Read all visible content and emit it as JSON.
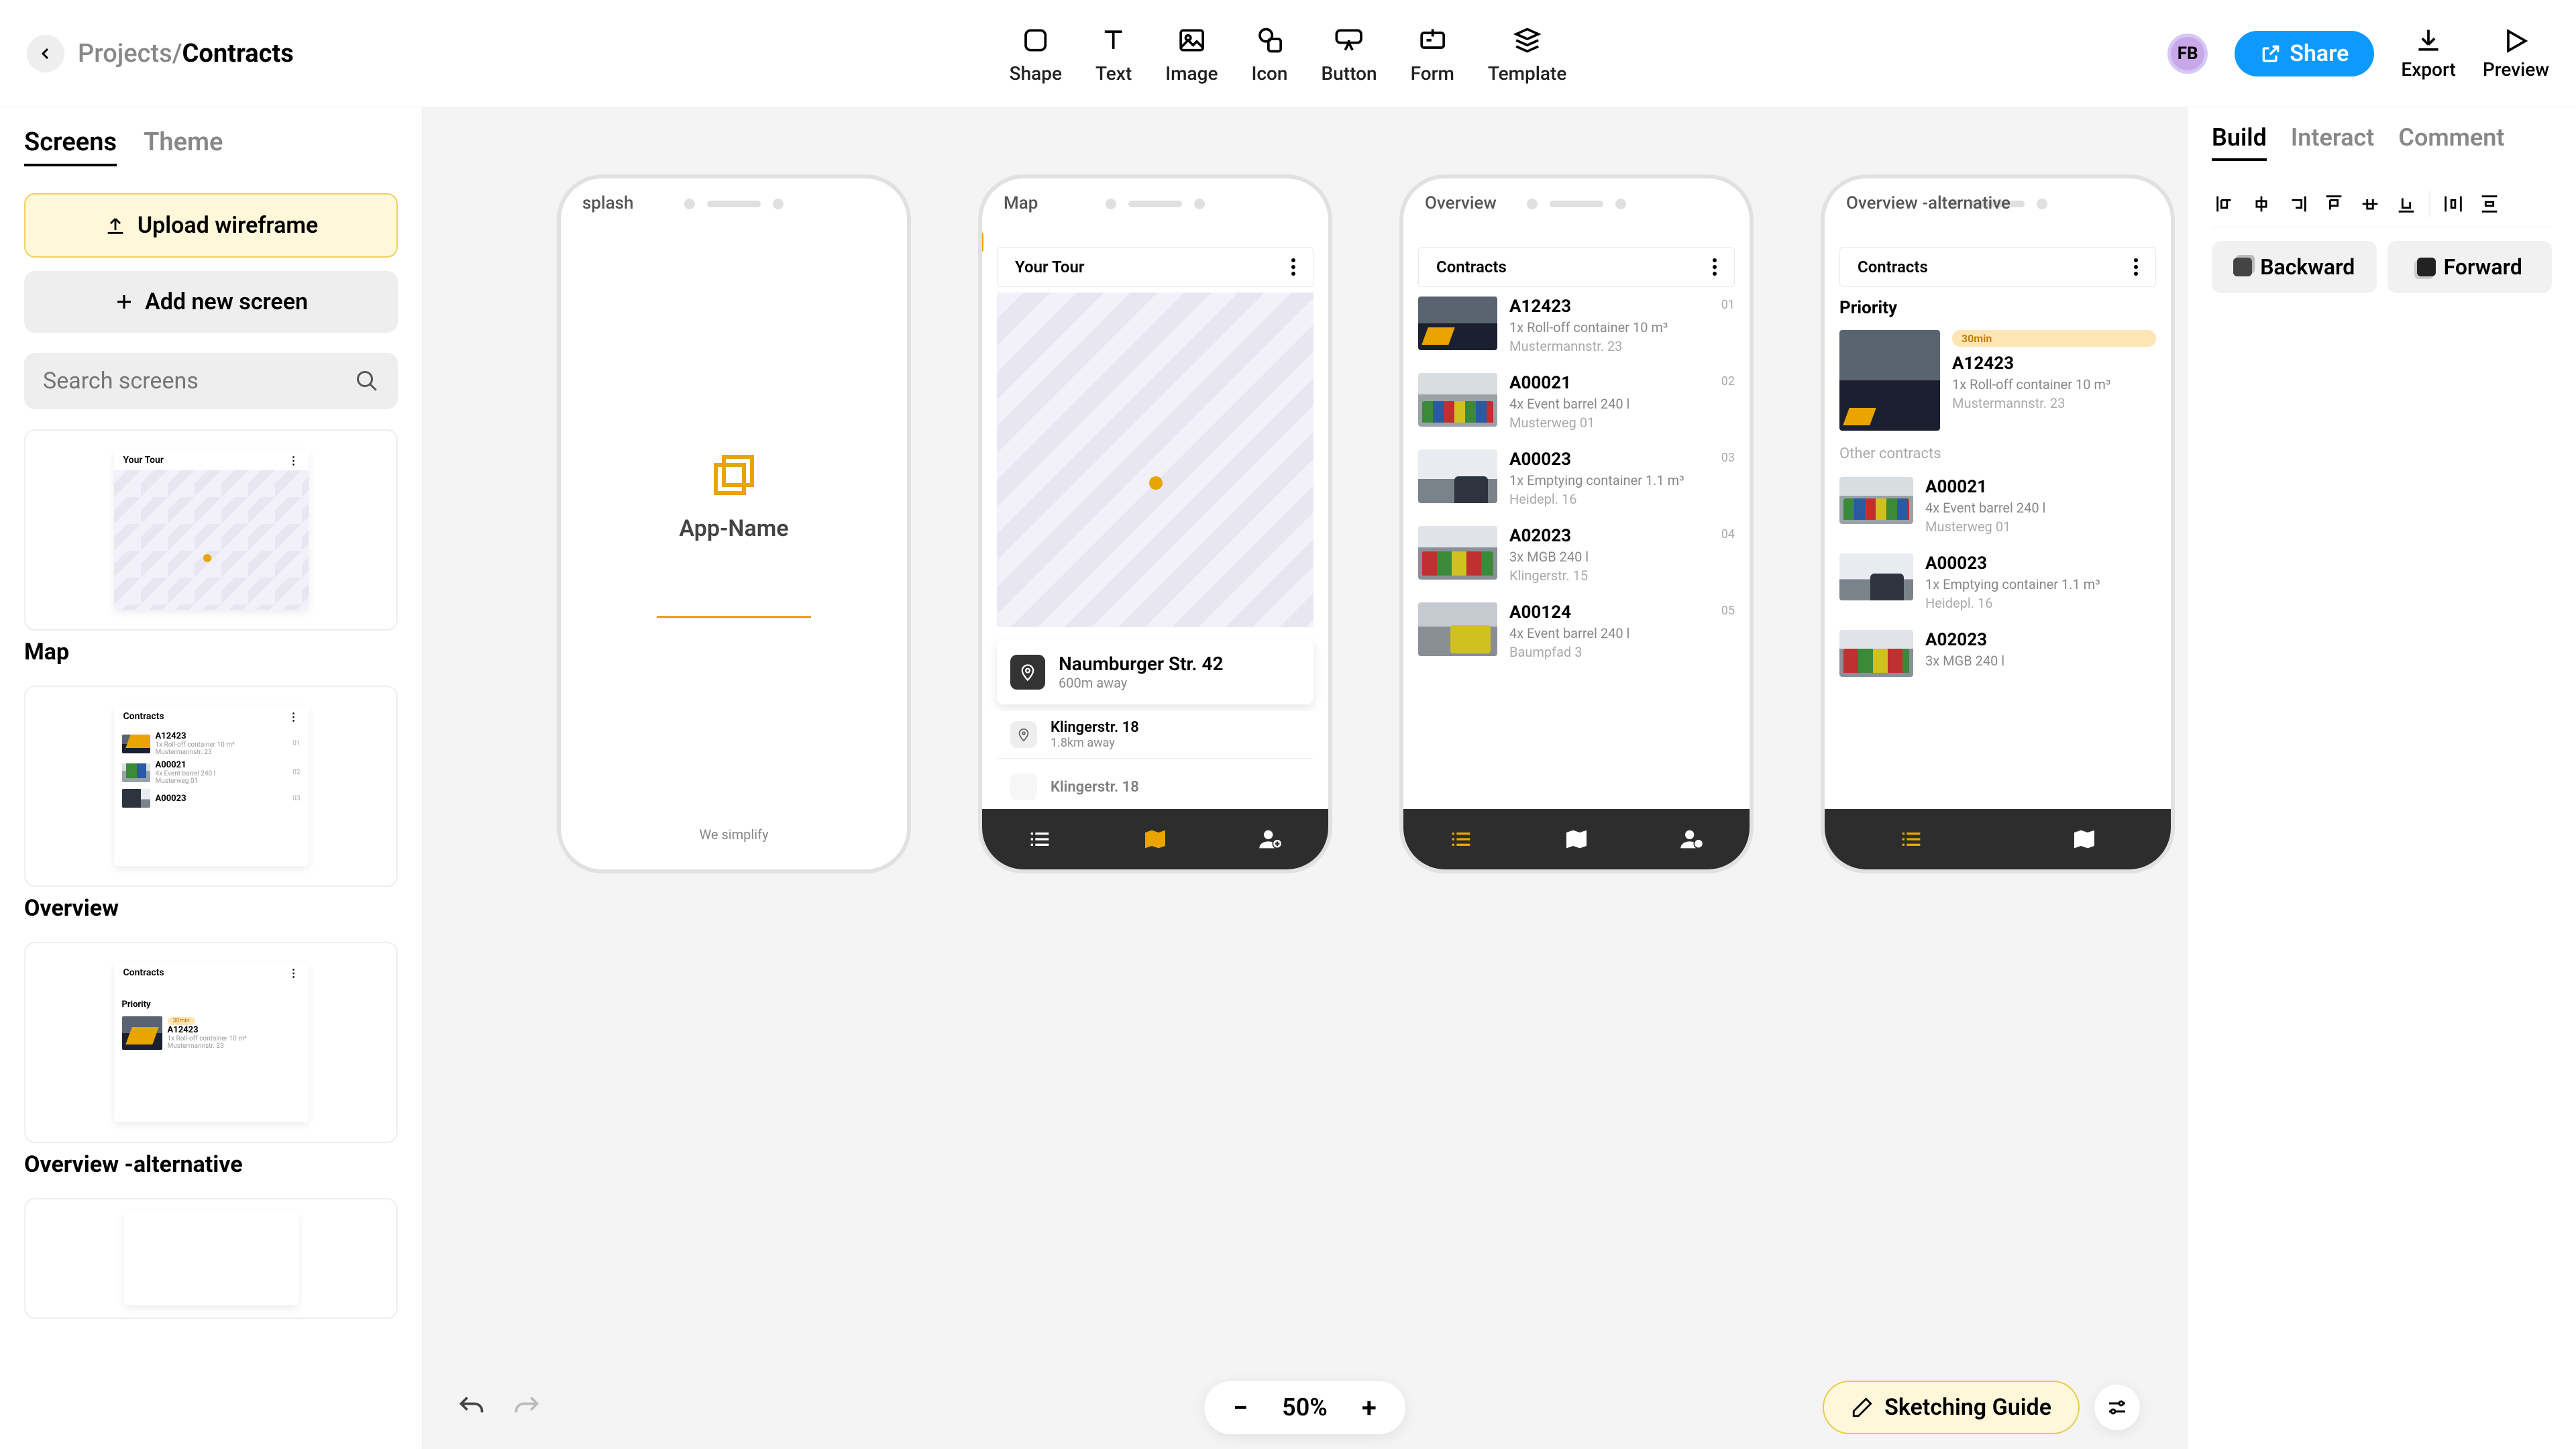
{
  "breadcrumb": {
    "projects": "Projects",
    "sep": "/",
    "current": "Contracts"
  },
  "toolbar": {
    "shape": "Shape",
    "text": "Text",
    "image": "Image",
    "icon": "Icon",
    "button": "Button",
    "form": "Form",
    "template": "Template"
  },
  "header": {
    "avatar": "FB",
    "share": "Share",
    "export": "Export",
    "preview": "Preview"
  },
  "leftPanel": {
    "tabs": {
      "screens": "Screens",
      "theme": "Theme"
    },
    "upload": "Upload wireframe",
    "add": "Add new screen",
    "searchPlaceholder": "Search screens",
    "screens": [
      {
        "title": "Map"
      },
      {
        "title": "Overview"
      },
      {
        "title": "Overview -alternative"
      }
    ]
  },
  "canvas": {
    "zoom": "50%",
    "sketchGuide": "Sketching Guide",
    "frames": {
      "splash": {
        "label": "splash",
        "appName": "App-Name",
        "footer": "We simplify"
      },
      "map": {
        "label": "Map",
        "barTitle": "Your Tour",
        "primary": {
          "title": "Naumburger Str. 42",
          "sub": "600m away"
        },
        "items": [
          {
            "title": "Klingerstr. 18",
            "sub": "1.8km away"
          },
          {
            "title": "Klingerstr. 18",
            "sub": ""
          }
        ]
      },
      "overview": {
        "label": "Overview",
        "barTitle": "Contracts",
        "items": [
          {
            "id": "A12423",
            "desc": "1x Roll-off container 10 m³",
            "addr": "Mustermannstr. 23",
            "num": "01",
            "t": "t1"
          },
          {
            "id": "A00021",
            "desc": "4x Event barrel 240 l",
            "addr": "Musterweg 01",
            "num": "02",
            "t": "t2"
          },
          {
            "id": "A00023",
            "desc": "1x Emptying container 1.1 m³",
            "addr": "Heidepl. 16",
            "num": "03",
            "t": "t3"
          },
          {
            "id": "A02023",
            "desc": "3x MGB 240 l",
            "addr": "Klingerstr. 15",
            "num": "04",
            "t": "t4"
          },
          {
            "id": "A00124",
            "desc": "4x Event barrel 240 l",
            "addr": "Baumpfad 3",
            "num": "05",
            "t": "t5"
          }
        ]
      },
      "overviewAlt": {
        "label": "Overview -alternative",
        "barTitle": "Contracts",
        "prioLabel": "Priority",
        "badge": "30min",
        "prio": {
          "id": "A12423",
          "desc": "1x Roll-off container 10 m³",
          "addr": "Mustermannstr. 23"
        },
        "otherLabel": "Other contracts",
        "items": [
          {
            "id": "A00021",
            "desc": "4x Event barrel 240 l",
            "addr": "Musterweg 01",
            "t": "t2"
          },
          {
            "id": "A00023",
            "desc": "1x Emptying container 1.1 m³",
            "addr": "Heidepl. 16",
            "t": "t3"
          },
          {
            "id": "A02023",
            "desc": "3x MGB 240 l",
            "addr": "",
            "t": "t4"
          }
        ]
      }
    }
  },
  "rightPanel": {
    "tabs": {
      "build": "Build",
      "interact": "Interact",
      "comment": "Comment"
    },
    "backward": "Backward",
    "forward": "Forward"
  },
  "thumbs": {
    "map": {
      "bar": "Your Tour"
    },
    "overview": {
      "bar": "Contracts",
      "rows": [
        {
          "id": "A12423",
          "desc": "1x Roll-off container 10 m³",
          "addr": "Mustermannstr. 23",
          "num": "01"
        },
        {
          "id": "A00021",
          "desc": "4x Event barrel 240 l",
          "addr": "Musterweg 01",
          "num": "02"
        },
        {
          "id": "A00023",
          "desc": "",
          "addr": "",
          "num": "03"
        }
      ]
    },
    "overviewAlt": {
      "bar": "Contracts",
      "prio": "Priority",
      "badge": "30min",
      "id": "A12423",
      "desc": "1x Roll-off container 10 m³",
      "addr": "Mustermannstr. 23"
    }
  }
}
